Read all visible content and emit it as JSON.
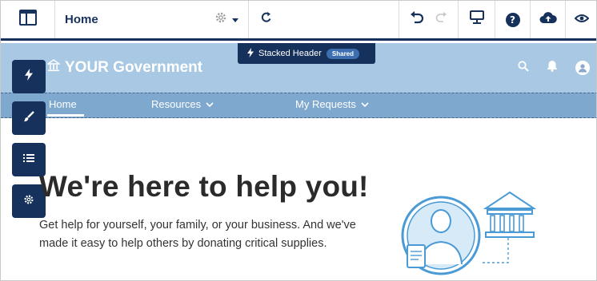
{
  "toolbar": {
    "page_name": "Home",
    "icons": {
      "menu": "builder-menu-icon",
      "settings": "gear-icon",
      "dropdown": "caret-down-icon",
      "refresh": "refresh-icon",
      "undo": "undo-icon",
      "redo": "redo-icon",
      "preview": "monitor-icon",
      "help": "help-icon",
      "publish": "cloud-upload-icon",
      "view": "eye-icon"
    },
    "help_glyph": "?"
  },
  "header": {
    "brand": "YOUR Government",
    "icons": [
      "search-icon",
      "bell-icon",
      "user-icon"
    ]
  },
  "stacked_header": {
    "label": "Stacked Header",
    "badge": "Shared"
  },
  "nav": {
    "items": [
      {
        "label": "Home"
      },
      {
        "label": "Resources"
      },
      {
        "label": "My Requests"
      }
    ]
  },
  "rail": {
    "buttons": [
      "lightning-icon",
      "brush-icon",
      "list-icon",
      "gear-icon"
    ]
  },
  "hero": {
    "title": "We're here to help you!",
    "body": "Get help for yourself, your family, or your business. And we've made it easy to help others by donating critical supplies."
  },
  "colors": {
    "navy": "#16325c",
    "header_bg": "#a9c8e3",
    "nav_bg": "#7fa8cf",
    "illustration_blue": "#4a9ad6"
  }
}
